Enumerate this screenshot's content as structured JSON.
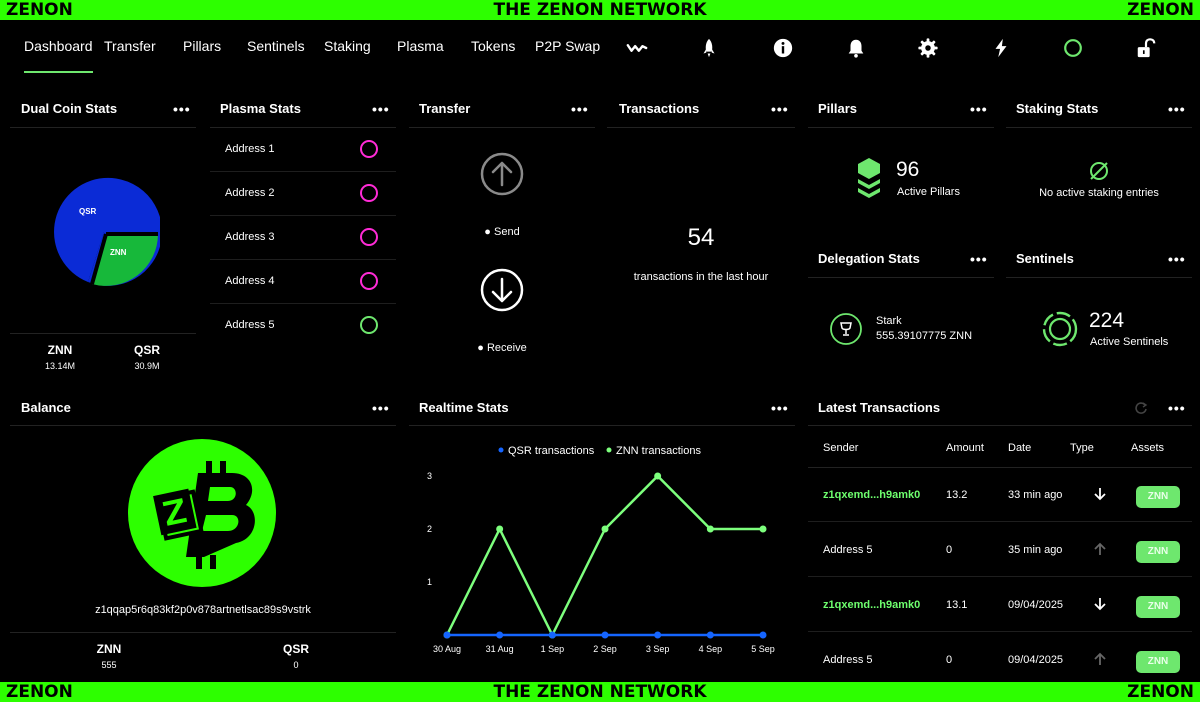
{
  "banner": {
    "left": "ZENON",
    "center": "THE ZENON NETWORK",
    "right": "ZENON"
  },
  "nav": {
    "tabs": [
      {
        "label": "Dashboard",
        "active": true
      },
      {
        "label": "Transfer"
      },
      {
        "label": "Pillars"
      },
      {
        "label": "Sentinels"
      },
      {
        "label": "Staking"
      },
      {
        "label": "Plasma"
      },
      {
        "label": "Tokens"
      },
      {
        "label": "P2P Swap"
      }
    ],
    "icons": [
      "wallet-connect-icon",
      "rocket-icon",
      "info-icon",
      "bell-icon",
      "gear-icon",
      "lightning-icon",
      "sync-status-icon",
      "unlock-icon"
    ]
  },
  "dual_coin": {
    "title": "Dual Coin Stats",
    "menu": "•••",
    "qsr_label": "QSR",
    "znn_label": "ZNN",
    "znn_supply": "13.14M",
    "qsr_supply": "30.9M",
    "colors": {
      "qsr": "#0b2bd6",
      "znn": "#17b83a"
    }
  },
  "plasma": {
    "title": "Plasma Stats",
    "menu": "•••",
    "addresses": [
      {
        "label": "Address 1",
        "color": "#ff2bd6"
      },
      {
        "label": "Address 2",
        "color": "#ff2bd6"
      },
      {
        "label": "Address 3",
        "color": "#ff2bd6"
      },
      {
        "label": "Address 4",
        "color": "#ff2bd6"
      },
      {
        "label": "Address 5",
        "color": "#6ee76e"
      }
    ]
  },
  "transfer": {
    "title": "Transfer",
    "menu": "•••",
    "send": "● Send",
    "receive": "● Receive"
  },
  "transactions": {
    "title": "Transactions",
    "menu": "•••",
    "count": "54",
    "caption": "transactions in the last hour"
  },
  "pillars": {
    "title": "Pillars",
    "menu": "•••",
    "count": "96",
    "caption": "Active Pillars"
  },
  "staking": {
    "title": "Staking Stats",
    "menu": "•••",
    "empty": "No active staking entries"
  },
  "delegation": {
    "title": "Delegation Stats",
    "menu": "•••",
    "name": "Stark",
    "amount": "555.39107775 ZNN"
  },
  "sentinels": {
    "title": "Sentinels",
    "menu": "•••",
    "count": "224",
    "caption": "Active Sentinels"
  },
  "balance": {
    "title": "Balance",
    "menu": "•••",
    "address": "z1qqap5r6q83kf2p0v878artnetlsac89s9vstrk",
    "znn_label": "ZNN",
    "znn_value": "555",
    "qsr_label": "QSR",
    "qsr_value": "0"
  },
  "realtime": {
    "title": "Realtime Stats",
    "menu": "•••",
    "legend_qsr": "QSR transactions",
    "legend_znn": "ZNN transactions"
  },
  "chart_data": {
    "type": "line",
    "categories": [
      "30 Aug",
      "31 Aug",
      "1 Sep",
      "2 Sep",
      "3 Sep",
      "4 Sep",
      "5 Sep"
    ],
    "series": [
      {
        "name": "QSR transactions",
        "color": "#1565ff",
        "values": [
          0,
          0,
          0,
          0,
          0,
          0,
          0
        ]
      },
      {
        "name": "ZNN transactions",
        "color": "#7dff7d",
        "values": [
          0,
          2,
          0,
          2,
          3,
          2,
          2
        ]
      }
    ],
    "yticks": [
      "1",
      "2",
      "3"
    ],
    "ylim": [
      0,
      3
    ],
    "legend": "top-center",
    "grid": false
  },
  "latest": {
    "title": "Latest Transactions",
    "menu": "•••",
    "headers": {
      "sender": "Sender",
      "amount": "Amount",
      "date": "Date",
      "type": "Type",
      "assets": "Assets"
    },
    "rows": [
      {
        "sender": "z1qxemd...h9amk0",
        "amount": "13.2",
        "date": "33 min ago",
        "type": "receive",
        "asset": "ZNN",
        "highlight": true
      },
      {
        "sender": "Address 5",
        "amount": "0",
        "date": "35 min ago",
        "type": "send",
        "asset": "ZNN",
        "highlight": false
      },
      {
        "sender": "z1qxemd...h9amk0",
        "amount": "13.1",
        "date": "09/04/2025",
        "type": "receive",
        "asset": "ZNN",
        "highlight": true
      },
      {
        "sender": "Address 5",
        "amount": "0",
        "date": "09/04/2025",
        "type": "send",
        "asset": "ZNN",
        "highlight": false
      }
    ]
  }
}
